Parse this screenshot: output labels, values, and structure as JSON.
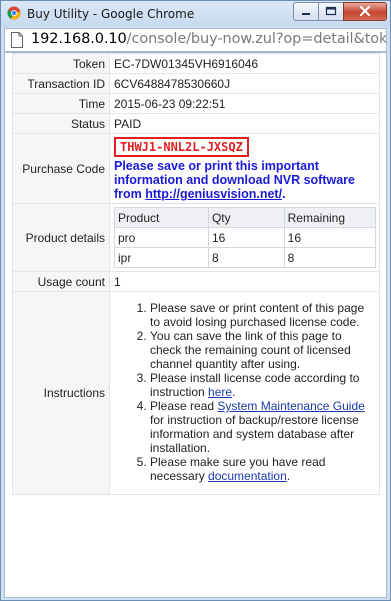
{
  "window": {
    "title": "Buy Utility - Google Chrome"
  },
  "addressbar": {
    "host": "192.168.0.10",
    "path": "/console/buy-now.zul?op=detail&toker"
  },
  "details": {
    "token_label": "Token",
    "token_value": "EC-7DW01345VH6916046",
    "transaction_label": "Transaction ID",
    "transaction_value": "6CV6488478530660J",
    "time_label": "Time",
    "time_value": "2015-06-23 09:22:51",
    "status_label": "Status",
    "status_value": "PAID",
    "purchase_label": "Purchase Code",
    "purchase_code": "THWJ1-NNL2L-JXSQZ",
    "notice_text": "Please save or print this important information and download NVR software from ",
    "notice_link": "http://geniusvision.net/",
    "notice_end": ".",
    "product_label": "Product details",
    "usage_label": "Usage count",
    "usage_value": "1",
    "instructions_label": "Instructions"
  },
  "products": {
    "headers": [
      "Product",
      "Qty",
      "Remaining"
    ],
    "rows": [
      [
        "pro",
        "16",
        "16"
      ],
      [
        "ipr",
        "8",
        "8"
      ]
    ]
  },
  "instructions": {
    "item1": "Please save or print content of this page to avoid losing purchased license code.",
    "item2": "You can save the link of this page to check the remaining count of licensed channel quantity after using.",
    "item3_text": "Please install license code according to instruction ",
    "item3_link": "here",
    "item3_end": ".",
    "item4_text": "Please read ",
    "item4_link": "System Maintenance Guide",
    "item4_end": " for instruction of backup/restore license information and system database after installation.",
    "item5_text": "Please make sure you have read necessary ",
    "item5_link": "documentation",
    "item5_end": "."
  },
  "colors": {
    "code_border": "#e02020",
    "notice_blue": "#1a1ad8",
    "link_blue": "#1b3aa8"
  }
}
